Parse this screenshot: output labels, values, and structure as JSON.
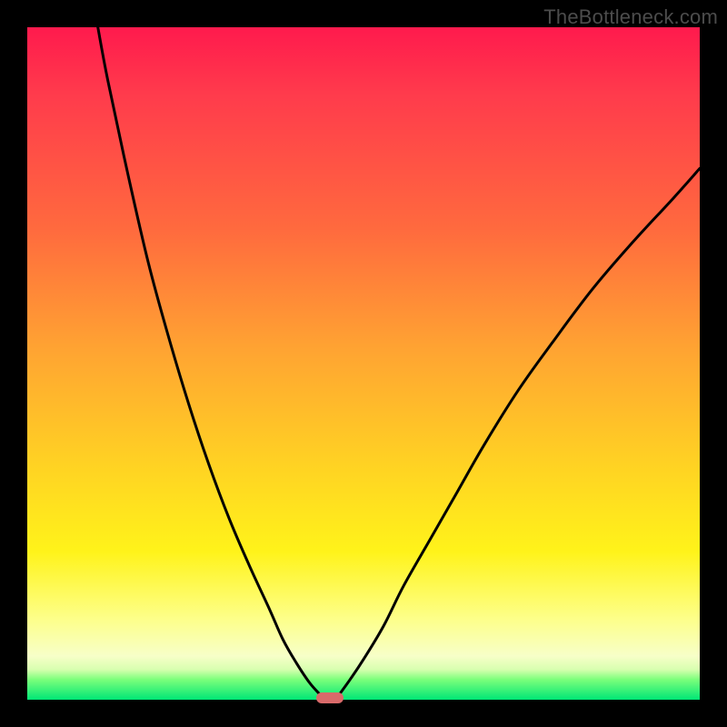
{
  "watermark": "TheBottleneck.com",
  "chart_data": {
    "type": "line",
    "title": "",
    "xlabel": "",
    "ylabel": "",
    "xlim": [
      0,
      100
    ],
    "ylim": [
      0,
      100
    ],
    "grid": false,
    "legend": false,
    "gradient_background": {
      "top": "#ff1a4d",
      "bottom": "#00e676",
      "note": "vertical gradient red→orange→yellow→pale→green representing score from bad (top) to good (bottom)"
    },
    "series": [
      {
        "name": "left-branch",
        "x": [
          10.5,
          12,
          15,
          18,
          21,
          24,
          27,
          30,
          33,
          36,
          38,
          40,
          42,
          43.8
        ],
        "y": [
          100,
          92,
          78,
          65,
          54,
          44,
          35,
          27,
          20,
          13.5,
          9,
          5.5,
          2.5,
          0.5
        ]
      },
      {
        "name": "right-branch",
        "x": [
          46.2,
          48,
          50,
          53,
          56,
          60,
          64,
          68,
          73,
          78,
          84,
          90,
          96,
          100
        ],
        "y": [
          0.5,
          3,
          6,
          11,
          17,
          24,
          31,
          38,
          46,
          53,
          61,
          68,
          74.5,
          79
        ]
      }
    ],
    "minimum_marker": {
      "x": 45,
      "y": 0,
      "color": "#d96a6a"
    }
  }
}
